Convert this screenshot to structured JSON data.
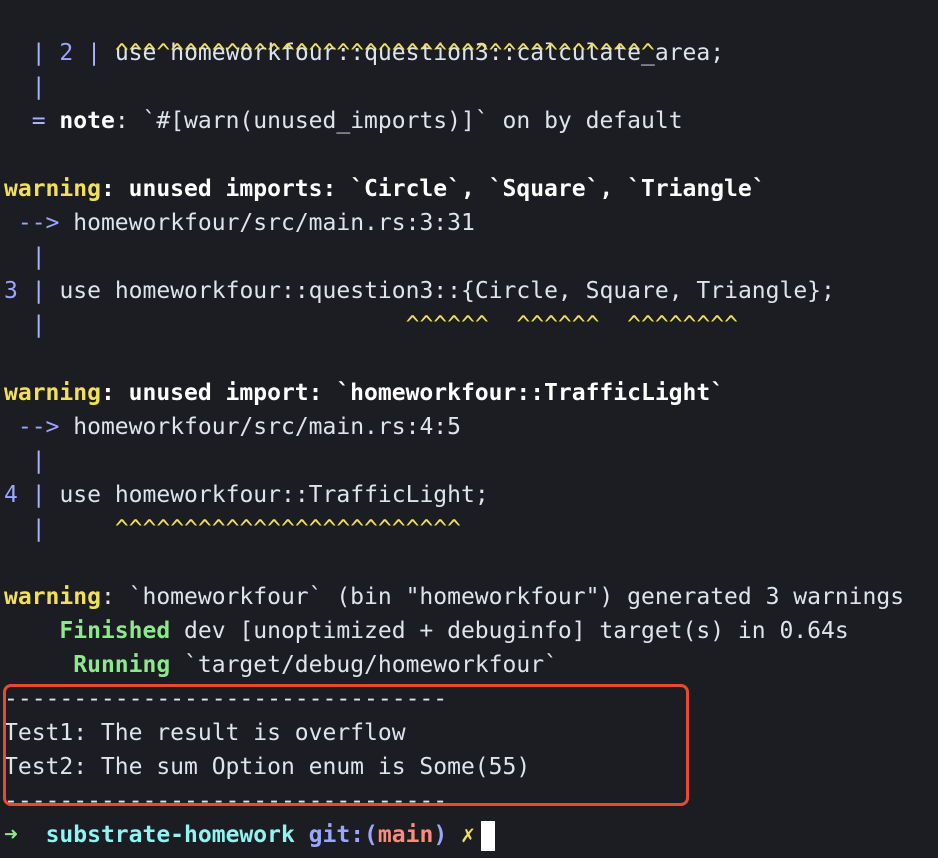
{
  "warnings": [
    {
      "label": "warning",
      "message": ": unused imports: `Circle`, `Square`, `Triangle`",
      "location": "homeworkfour/src/main.rs:3:31",
      "line_no": "3",
      "code": "use homeworkfour::question3::{Circle, Square, Triangle};",
      "caret": "^^^^^^  ^^^^^^  ^^^^^^^^"
    },
    {
      "label": "warning",
      "message": ": unused import: `homeworkfour::TrafficLight`",
      "location": "homeworkfour/src/main.rs:4:5",
      "line_no": "4",
      "code": "use homeworkfour::TrafficLight;",
      "caret": "^^^^^^^^^^^^^^^^^^^^^^^^^"
    }
  ],
  "top": {
    "line_no": "2",
    "code": "use homeworkfour::question3::calculate_area;",
    "caret": "^^^^^^^^^^^^^^^^^^^^^^^^^^^^^^^^^^^^^^^",
    "note_label": "note",
    "note_text": ": `#[warn(unused_imports)]` on by default"
  },
  "summary": {
    "label": "warning",
    "text": ": `homeworkfour` (bin \"homeworkfour\") generated 3 warnings"
  },
  "build": {
    "finished_label": "Finished",
    "finished_text": " dev [unoptimized + debuginfo] target(s) in 0.64s",
    "running_label": "Running",
    "running_text": " `target/debug/homeworkfour`"
  },
  "output": {
    "separator_top": "--------------------------------",
    "test1": "Test1: The result is overflow",
    "test2": "Test2: The sum Option enum is Some(55)",
    "separator_bottom": "--------------------------------"
  },
  "prompt": {
    "arrow": "➜",
    "directory": "substrate-homework",
    "git_label": "git:(",
    "branch": "main",
    "git_close": ")",
    "dirty_mark": "✗"
  },
  "glyphs": {
    "pipe": "|",
    "eq": "=",
    "arrow": "-->"
  },
  "colors": {
    "background": "#1b1d23",
    "warning": "#f2e05a",
    "success": "#8ee88c",
    "highlight_box": "#e84a2f"
  }
}
